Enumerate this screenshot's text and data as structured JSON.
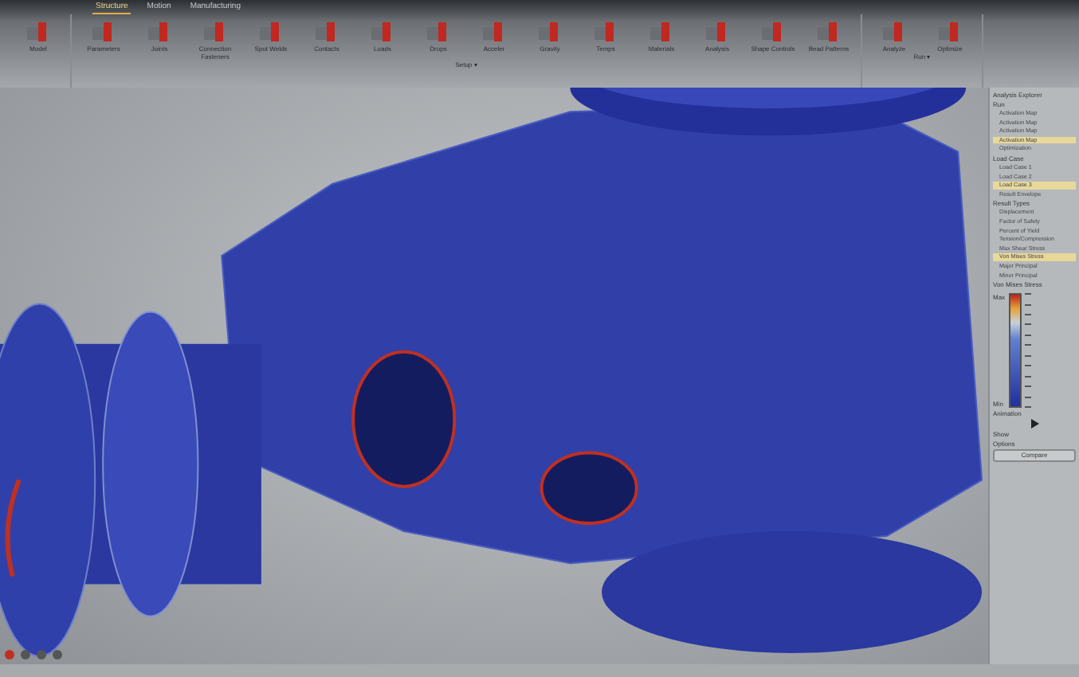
{
  "tabs": [
    {
      "label": "Structure",
      "selected": true
    },
    {
      "label": "Motion",
      "selected": false
    },
    {
      "label": "Manufacturing",
      "selected": false
    }
  ],
  "toolbar": {
    "groups": [
      {
        "items": [
          "Model"
        ]
      },
      {
        "label": "Setup ▾",
        "items": [
          "Parameters",
          "Joints",
          "Connection Fasteners",
          "Spot Welds",
          "Contacts",
          "Loads",
          "Drops",
          "Acceler",
          "Gravity",
          "Temps",
          "Materials",
          "Analysis",
          "Shape Controls",
          "Bead Patterns"
        ]
      },
      {
        "label": "Run ▾",
        "items": [
          "Analyze",
          "Optimize"
        ]
      }
    ]
  },
  "explorer": {
    "title": "Analysis Explorer",
    "sections": [
      {
        "title": "Run",
        "items": [
          {
            "label": "Activation Map",
            "selected": false
          },
          {
            "label": "Activation Map",
            "selected": false
          },
          {
            "label": "Activation Map",
            "selected": false
          },
          {
            "label": "Activation Map",
            "selected": true
          },
          {
            "label": "Optimization",
            "selected": false
          }
        ]
      },
      {
        "title": "Load Case",
        "items": [
          {
            "label": "Load Case 1",
            "selected": false
          },
          {
            "label": "Load Case 2",
            "selected": false
          },
          {
            "label": "Load Case 3",
            "selected": true
          },
          {
            "label": "Result Envelope",
            "selected": false
          }
        ]
      },
      {
        "title": "Result Types",
        "items": [
          {
            "label": "Displacement",
            "selected": false
          },
          {
            "label": "Factor of Safety",
            "selected": false
          },
          {
            "label": "Percent of Yield",
            "selected": false
          },
          {
            "label": "Tension/Compression",
            "selected": false
          },
          {
            "label": "Max Shear Stress",
            "selected": false
          },
          {
            "label": "Von Mises Stress",
            "selected": true
          },
          {
            "label": "Major Principal",
            "selected": false
          },
          {
            "label": "Minor Principal",
            "selected": false
          }
        ]
      }
    ],
    "legend": {
      "title": "Von Mises Stress",
      "max": "Max",
      "min": "Min"
    },
    "animation": "Animation",
    "show": "Show",
    "options": "Options",
    "compare": "Compare"
  }
}
